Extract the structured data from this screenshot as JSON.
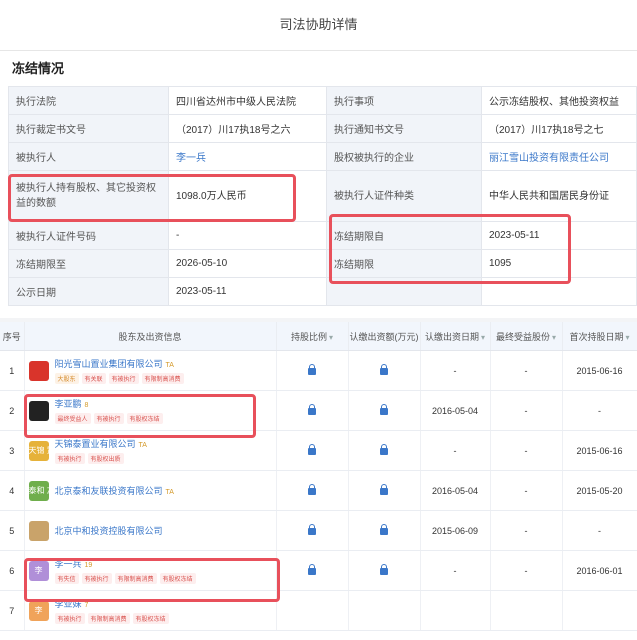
{
  "header": {
    "title": "司法协助详情"
  },
  "section": {
    "title": "冻结情况"
  },
  "details": {
    "r1": {
      "l1": "执行法院",
      "v1": "四川省达州市中级人民法院",
      "l2": "执行事项",
      "v2": "公示冻结股权、其他投资权益"
    },
    "r2": {
      "l1": "执行裁定书文号",
      "v1": "（2017）川17执18号之六",
      "l2": "执行通知书文号",
      "v2": "（2017）川17执18号之七"
    },
    "r3": {
      "l1": "被执行人",
      "v1": "李一兵",
      "l2": "股权被执行的企业",
      "v2": "丽江雪山投资有限责任公司"
    },
    "r4": {
      "l1": "被执行人持有股权、其它投资权益的数额",
      "v1": "1098.0万人民币",
      "l2": "被执行人证件种类",
      "v2": "中华人民共和国居民身份证"
    },
    "r5": {
      "l1": "被执行人证件号码",
      "v1": "-",
      "l2": "冻结期限自",
      "v2": "2023-05-11"
    },
    "r6": {
      "l1": "冻结期限至",
      "v1": "2026-05-10",
      "l2": "冻结期限",
      "v2": "1095"
    },
    "r7": {
      "l1": "公示日期",
      "v1": "2023-05-11"
    }
  },
  "shareholders": {
    "headers": {
      "idx": "序号",
      "name": "股东及出资信息",
      "ratio": "持股比例",
      "amount": "认缴出资额(万元)",
      "date": "认缴出资日期",
      "final": "最终受益股份",
      "first": "首次持股日期"
    },
    "rows": [
      {
        "idx": "1",
        "name": "阳光雪山置业集团有限公司",
        "badge": "TA",
        "logo": "",
        "logo_color": "#d9342b",
        "tags": [
          "大股东",
          "有关联",
          "有被执行",
          "有限制高消费"
        ],
        "date": "-",
        "final": "-",
        "first": "2015-06-16"
      },
      {
        "idx": "2",
        "name": "李亚鹏",
        "badge": "8",
        "logo": "",
        "logo_color": "#222222",
        "tags": [
          "最终受益人",
          "有被执行",
          "有股权冻结"
        ],
        "date": "2016-05-04",
        "final": "-",
        "first": "-"
      },
      {
        "idx": "3",
        "name": "天锦泰置业有限公司",
        "badge": "TA",
        "logo": "天锦 置业",
        "logo_color": "#e6b23a",
        "tags": [
          "有被执行",
          "有股权出质"
        ],
        "date": "-",
        "final": "-",
        "first": "2015-06-16"
      },
      {
        "idx": "4",
        "name": "北京泰和友联投资有限公司",
        "badge": "TA",
        "logo": "泰和 友联",
        "logo_color": "#6fae4c",
        "tags": [],
        "date": "2016-05-04",
        "final": "-",
        "first": "2015-05-20"
      },
      {
        "idx": "5",
        "name": "北京中和投资控股有限公司",
        "badge": "",
        "logo": "",
        "logo_color": "#c9a36a",
        "tags": [],
        "date": "2015-06-09",
        "final": "-",
        "first": "-"
      },
      {
        "idx": "6",
        "name": "李一兵",
        "badge": "19",
        "logo": "李",
        "logo_color": "#b08fd8",
        "tags": [
          "有失信",
          "有被执行",
          "有限制高消费",
          "有股权冻结"
        ],
        "date": "-",
        "final": "-",
        "first": "2016-06-01"
      },
      {
        "idx": "7",
        "name": "李亚妹",
        "badge": "7",
        "logo": "李",
        "logo_color": "#f0a35a",
        "tags": [
          "有被执行",
          "有限制高消费",
          "有股权冻结"
        ],
        "date": "",
        "final": "",
        "first": ""
      }
    ]
  },
  "colors": {
    "highlight": "#e8505b",
    "link": "#3a77c9",
    "tag_text": "#d9534f"
  }
}
